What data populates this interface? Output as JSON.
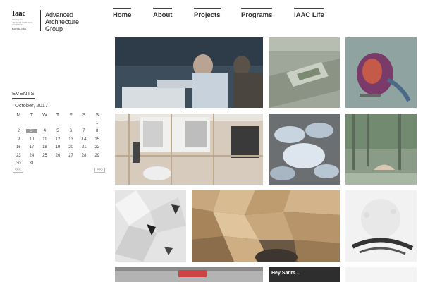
{
  "header": {
    "logo_mark": "Iaac",
    "logo_sub": "Institute for\nadvanced architecture\nof Catalonia",
    "logo_city": "BARCELONA",
    "group_name": "Advanced Architecture Group"
  },
  "nav": {
    "items": [
      "Home",
      "About",
      "Projects",
      "Programs",
      "IAAC Life"
    ]
  },
  "events": {
    "title": "EVENTS",
    "month": "October, 2017",
    "weekdays": [
      "M",
      "T",
      "W",
      "T",
      "F",
      "S",
      "S"
    ],
    "weeks": [
      [
        "",
        "",
        "",
        "",
        "",
        "",
        "1"
      ],
      [
        "2",
        "3",
        "4",
        "5",
        "6",
        "7",
        "8"
      ],
      [
        "9",
        "10",
        "11",
        "12",
        "13",
        "14",
        "15"
      ],
      [
        "16",
        "17",
        "18",
        "19",
        "20",
        "21",
        "22"
      ],
      [
        "23",
        "24",
        "25",
        "26",
        "27",
        "28",
        "29"
      ],
      [
        "30",
        "31",
        "",
        "",
        "",
        "",
        ""
      ]
    ],
    "today": "3",
    "prev_label": "<<<",
    "next_label": ">>>"
  },
  "gallery": {
    "caption_hey_sants": "Hey Sants..."
  }
}
